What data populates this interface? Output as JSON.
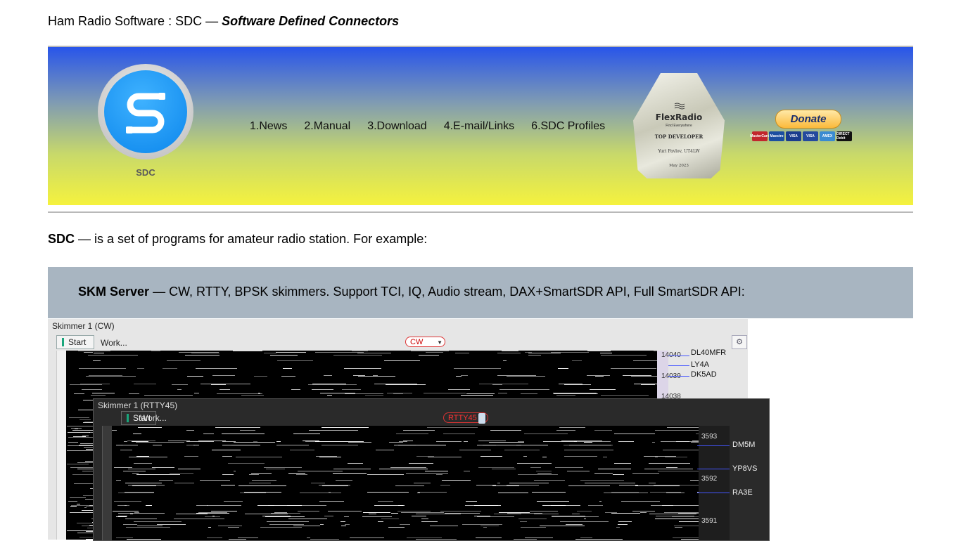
{
  "header": {
    "prefix": "Ham Radio Software : SDC — ",
    "title_bold": "Software Defined Connectors"
  },
  "banner": {
    "logo_caption": "SDC",
    "nav": [
      "1.News",
      "2.Manual",
      "3.Download",
      "4.E-mail/Links",
      "6.SDC Profiles"
    ],
    "award": {
      "brand": "FlexRadio",
      "subtitle": "Find Everywhere",
      "title": "TOP DEVELOPER",
      "name": "Yuri Pavlov, UT4LW",
      "date": "May 2023"
    },
    "donate_label": "Donate",
    "cards": [
      {
        "label": "MasterCard",
        "color": "#c2272d"
      },
      {
        "label": "Maestro",
        "color": "#1c4fa1"
      },
      {
        "label": "VISA",
        "color": "#1a3c8e"
      },
      {
        "label": "VISA",
        "color": "#244a9e"
      },
      {
        "label": "AMEX",
        "color": "#3a8bd1"
      },
      {
        "label": "DIRECT Debit",
        "color": "#111111"
      }
    ]
  },
  "intro": {
    "bold": "SDC",
    "text": " — is a set of programs for amateur radio station. For example:"
  },
  "skm": {
    "bold": "SKM Server",
    "text": " — CW, RTTY, BPSK skimmers. Support TCI, IQ, Audio stream, DAX+SmartSDR API, Full SmartSDR API:"
  },
  "skimmer_cw": {
    "title": "Skimmer 1 (CW)",
    "start": "Start",
    "work": "Work...",
    "mode": "CW",
    "ticks": [
      "14040",
      "14039",
      "14038"
    ],
    "calls": [
      "DL40MFR",
      "LY4A",
      "DK5AD"
    ]
  },
  "skimmer_rtty": {
    "title": "Skimmer 1 (RTTY45)",
    "start": "Start",
    "work": "Work...",
    "mode": "RTTY45",
    "ticks": [
      "3593",
      "3592",
      "3591"
    ],
    "calls": [
      "DM5M",
      "YP8VS",
      "RA3E"
    ]
  }
}
